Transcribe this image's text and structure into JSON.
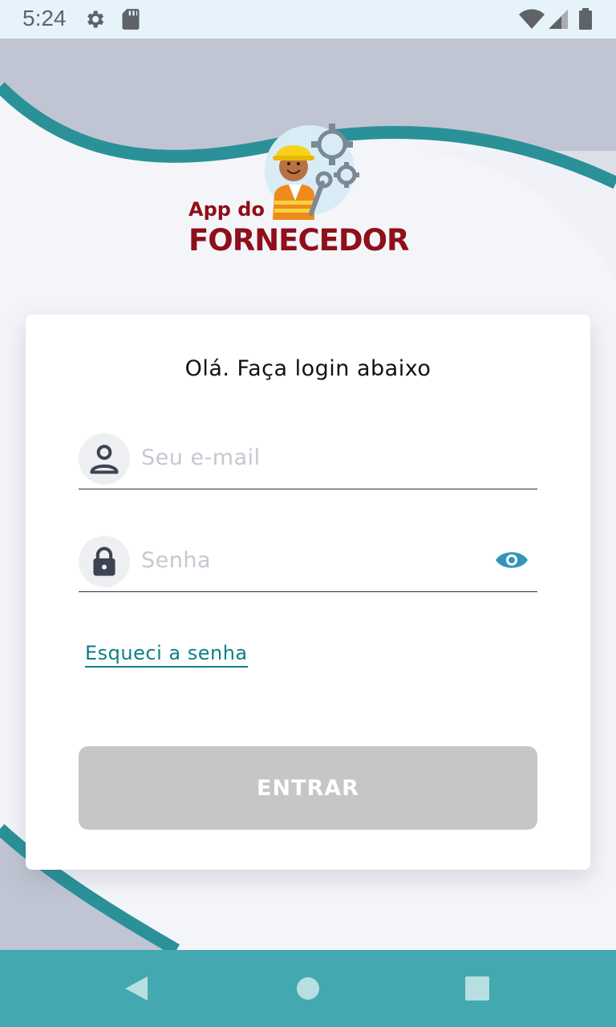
{
  "status_bar": {
    "time": "5:24",
    "icons": [
      "gear-icon",
      "sd-card-icon",
      "wifi-icon",
      "signal-icon",
      "battery-icon"
    ]
  },
  "logo": {
    "line1": "App do",
    "line2": "FORNECEDOR"
  },
  "login": {
    "title": "Olá. Faça login abaixo",
    "email_placeholder": "Seu e-mail",
    "email_value": "",
    "password_placeholder": "Senha",
    "password_value": "",
    "forgot_label": "Esqueci a senha",
    "submit_label": "ENTRAR"
  },
  "nav": {
    "buttons": [
      "back-icon",
      "home-icon",
      "recents-icon"
    ]
  },
  "colors": {
    "teal": "#2a9199",
    "brand_red": "#8f0f1a",
    "link": "#0e7f86",
    "eye": "#3196b7",
    "button_disabled": "#c6c6c6",
    "navbar": "#43a8b0"
  }
}
